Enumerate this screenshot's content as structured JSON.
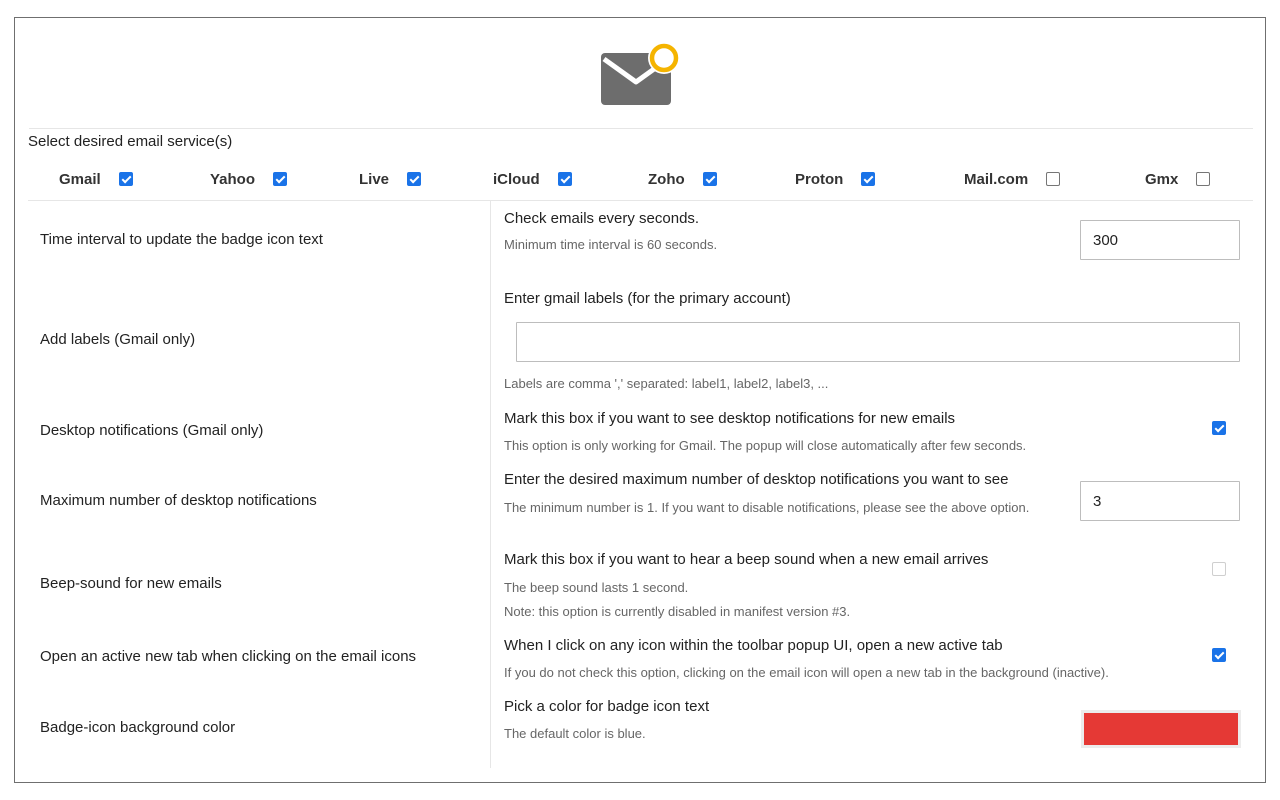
{
  "logo": {
    "icon": "envelope-with-notification-icon",
    "envelope_color": "#6d6d6d",
    "dot_color": "#f5b400"
  },
  "services": {
    "title": "Select desired email service(s)",
    "items": [
      {
        "label": "Gmail",
        "checked": true
      },
      {
        "label": "Yahoo",
        "checked": true
      },
      {
        "label": "Live",
        "checked": true
      },
      {
        "label": "iCloud",
        "checked": true
      },
      {
        "label": "Zoho",
        "checked": true
      },
      {
        "label": "Proton",
        "checked": true
      },
      {
        "label": "Mail.com",
        "checked": false
      },
      {
        "label": "Gmx",
        "checked": false
      }
    ]
  },
  "settings": {
    "interval": {
      "label": "Time interval to update the badge icon text",
      "title": "Check emails every seconds.",
      "hint": "Minimum time interval is 60 seconds.",
      "value": "300"
    },
    "labels": {
      "label": "Add labels (Gmail only)",
      "title": "Enter gmail labels (for the primary account)",
      "value": "",
      "hint": "Labels are comma ',' separated: label1, label2, label3, ..."
    },
    "notifications": {
      "label": "Desktop notifications (Gmail only)",
      "title": "Mark this box if you want to see desktop notifications for new emails",
      "hint": "This option is only working for Gmail. The popup will close automatically after few seconds.",
      "checked": true
    },
    "max_notifications": {
      "label": "Maximum number of desktop notifications",
      "title": "Enter the desired maximum number of desktop notifications you want to see",
      "hint": "The minimum number is 1. If you want to disable notifications, please see the above option.",
      "value": "3"
    },
    "beep": {
      "label": "Beep-sound for new emails",
      "title": "Mark this box if you want to hear a beep sound when a new email arrives",
      "hint1": "The beep sound lasts 1 second.",
      "hint2": "Note: this option is currently disabled in manifest version #3.",
      "checked": false,
      "disabled": true
    },
    "active_tab": {
      "label": "Open an active new tab when clicking on the email icons",
      "title": "When I click on any icon within the toolbar popup UI, open a new active tab",
      "hint": "If you do not check this option, clicking on the email icon will open a new tab in the background (inactive).",
      "checked": true
    },
    "badge_color": {
      "label": "Badge-icon background color",
      "title": "Pick a color for badge icon text",
      "hint": "The default color is blue.",
      "value": "#e53935"
    }
  }
}
